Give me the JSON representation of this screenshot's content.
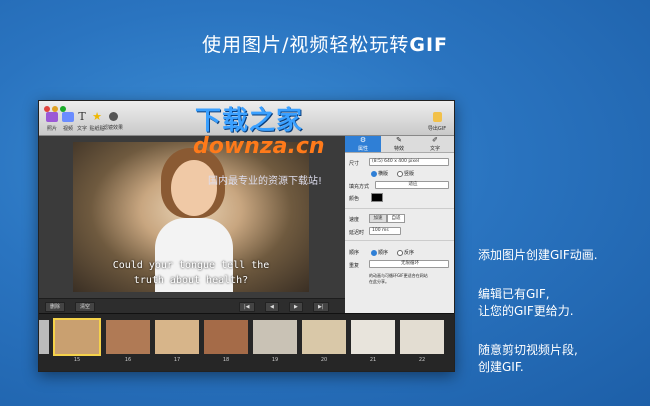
{
  "headline": {
    "part1": "使用图片/视频轻松玩转",
    "part2": "GIF"
  },
  "features": [
    [
      "添加图片创建GIF动画."
    ],
    [
      "编辑已有GIF,",
      "让您的GIF更给力."
    ],
    [
      "随意剪切视频片段,",
      "创建GIF."
    ]
  ],
  "toolbar": {
    "items": [
      {
        "label": "照片",
        "icon": "photo-icon",
        "color": "#9b59d6"
      },
      {
        "label": "视频",
        "icon": "video-icon",
        "color": "#6a8cff"
      },
      {
        "label": "文字",
        "icon": "text-icon",
        "color": "#333333"
      },
      {
        "label": "贴纸贴",
        "icon": "star-icon",
        "color": "#f0b800"
      },
      {
        "label": "滤镜效果",
        "icon": "filter-icon",
        "color": "#555555"
      }
    ],
    "export_label": "导出GIF"
  },
  "video": {
    "caption_line1": "Could your tongue tell the",
    "caption_line2": "truth about health?"
  },
  "panel": {
    "tabs": [
      {
        "label": "属性",
        "icon": "gear-icon"
      },
      {
        "label": "特效",
        "icon": "wand-icon"
      },
      {
        "label": "文字",
        "icon": "edit-icon"
      }
    ],
    "size_label": "尺寸",
    "size_value": "(8:5) 640 x 400 pixel",
    "orientation_options": [
      "横版",
      "竖版"
    ],
    "fill_label": "填充方式",
    "fill_value": "适应",
    "color_label": "颜色",
    "speed_label": "速度",
    "speed_options": [
      "加速",
      "自适"
    ],
    "delay_label": "延迟时",
    "delay_value": "100 ms",
    "order_label": "顺序",
    "order_options": [
      "顺序",
      "反序"
    ],
    "loop_label": "重复",
    "loop_value": "无限循环",
    "hint_text": "的动画与可循环GIF更适合在网站",
    "hint_text2": "在此分享。"
  },
  "bottom_buttons": [
    "删除",
    "清空"
  ],
  "playback_controls": [
    "skip-start-icon",
    "step-back-icon",
    "step-forward-icon",
    "skip-end-icon"
  ],
  "filmstrip": {
    "frames": [
      {
        "number": "15",
        "color": "#c9a070"
      },
      {
        "number": "16",
        "color": "#b07a55"
      },
      {
        "number": "17",
        "color": "#d7b58a"
      },
      {
        "number": "18",
        "color": "#a56b48"
      },
      {
        "number": "19",
        "color": "#c9c2b5"
      },
      {
        "number": "20",
        "color": "#d9c8a8"
      },
      {
        "number": "21",
        "color": "#e8e4dc"
      },
      {
        "number": "22",
        "color": "#e3ddd2"
      }
    ]
  },
  "watermark": {
    "title": "下载之家",
    "domain": "downza.cn",
    "slogan": "国内最专业的资源下载站!"
  }
}
